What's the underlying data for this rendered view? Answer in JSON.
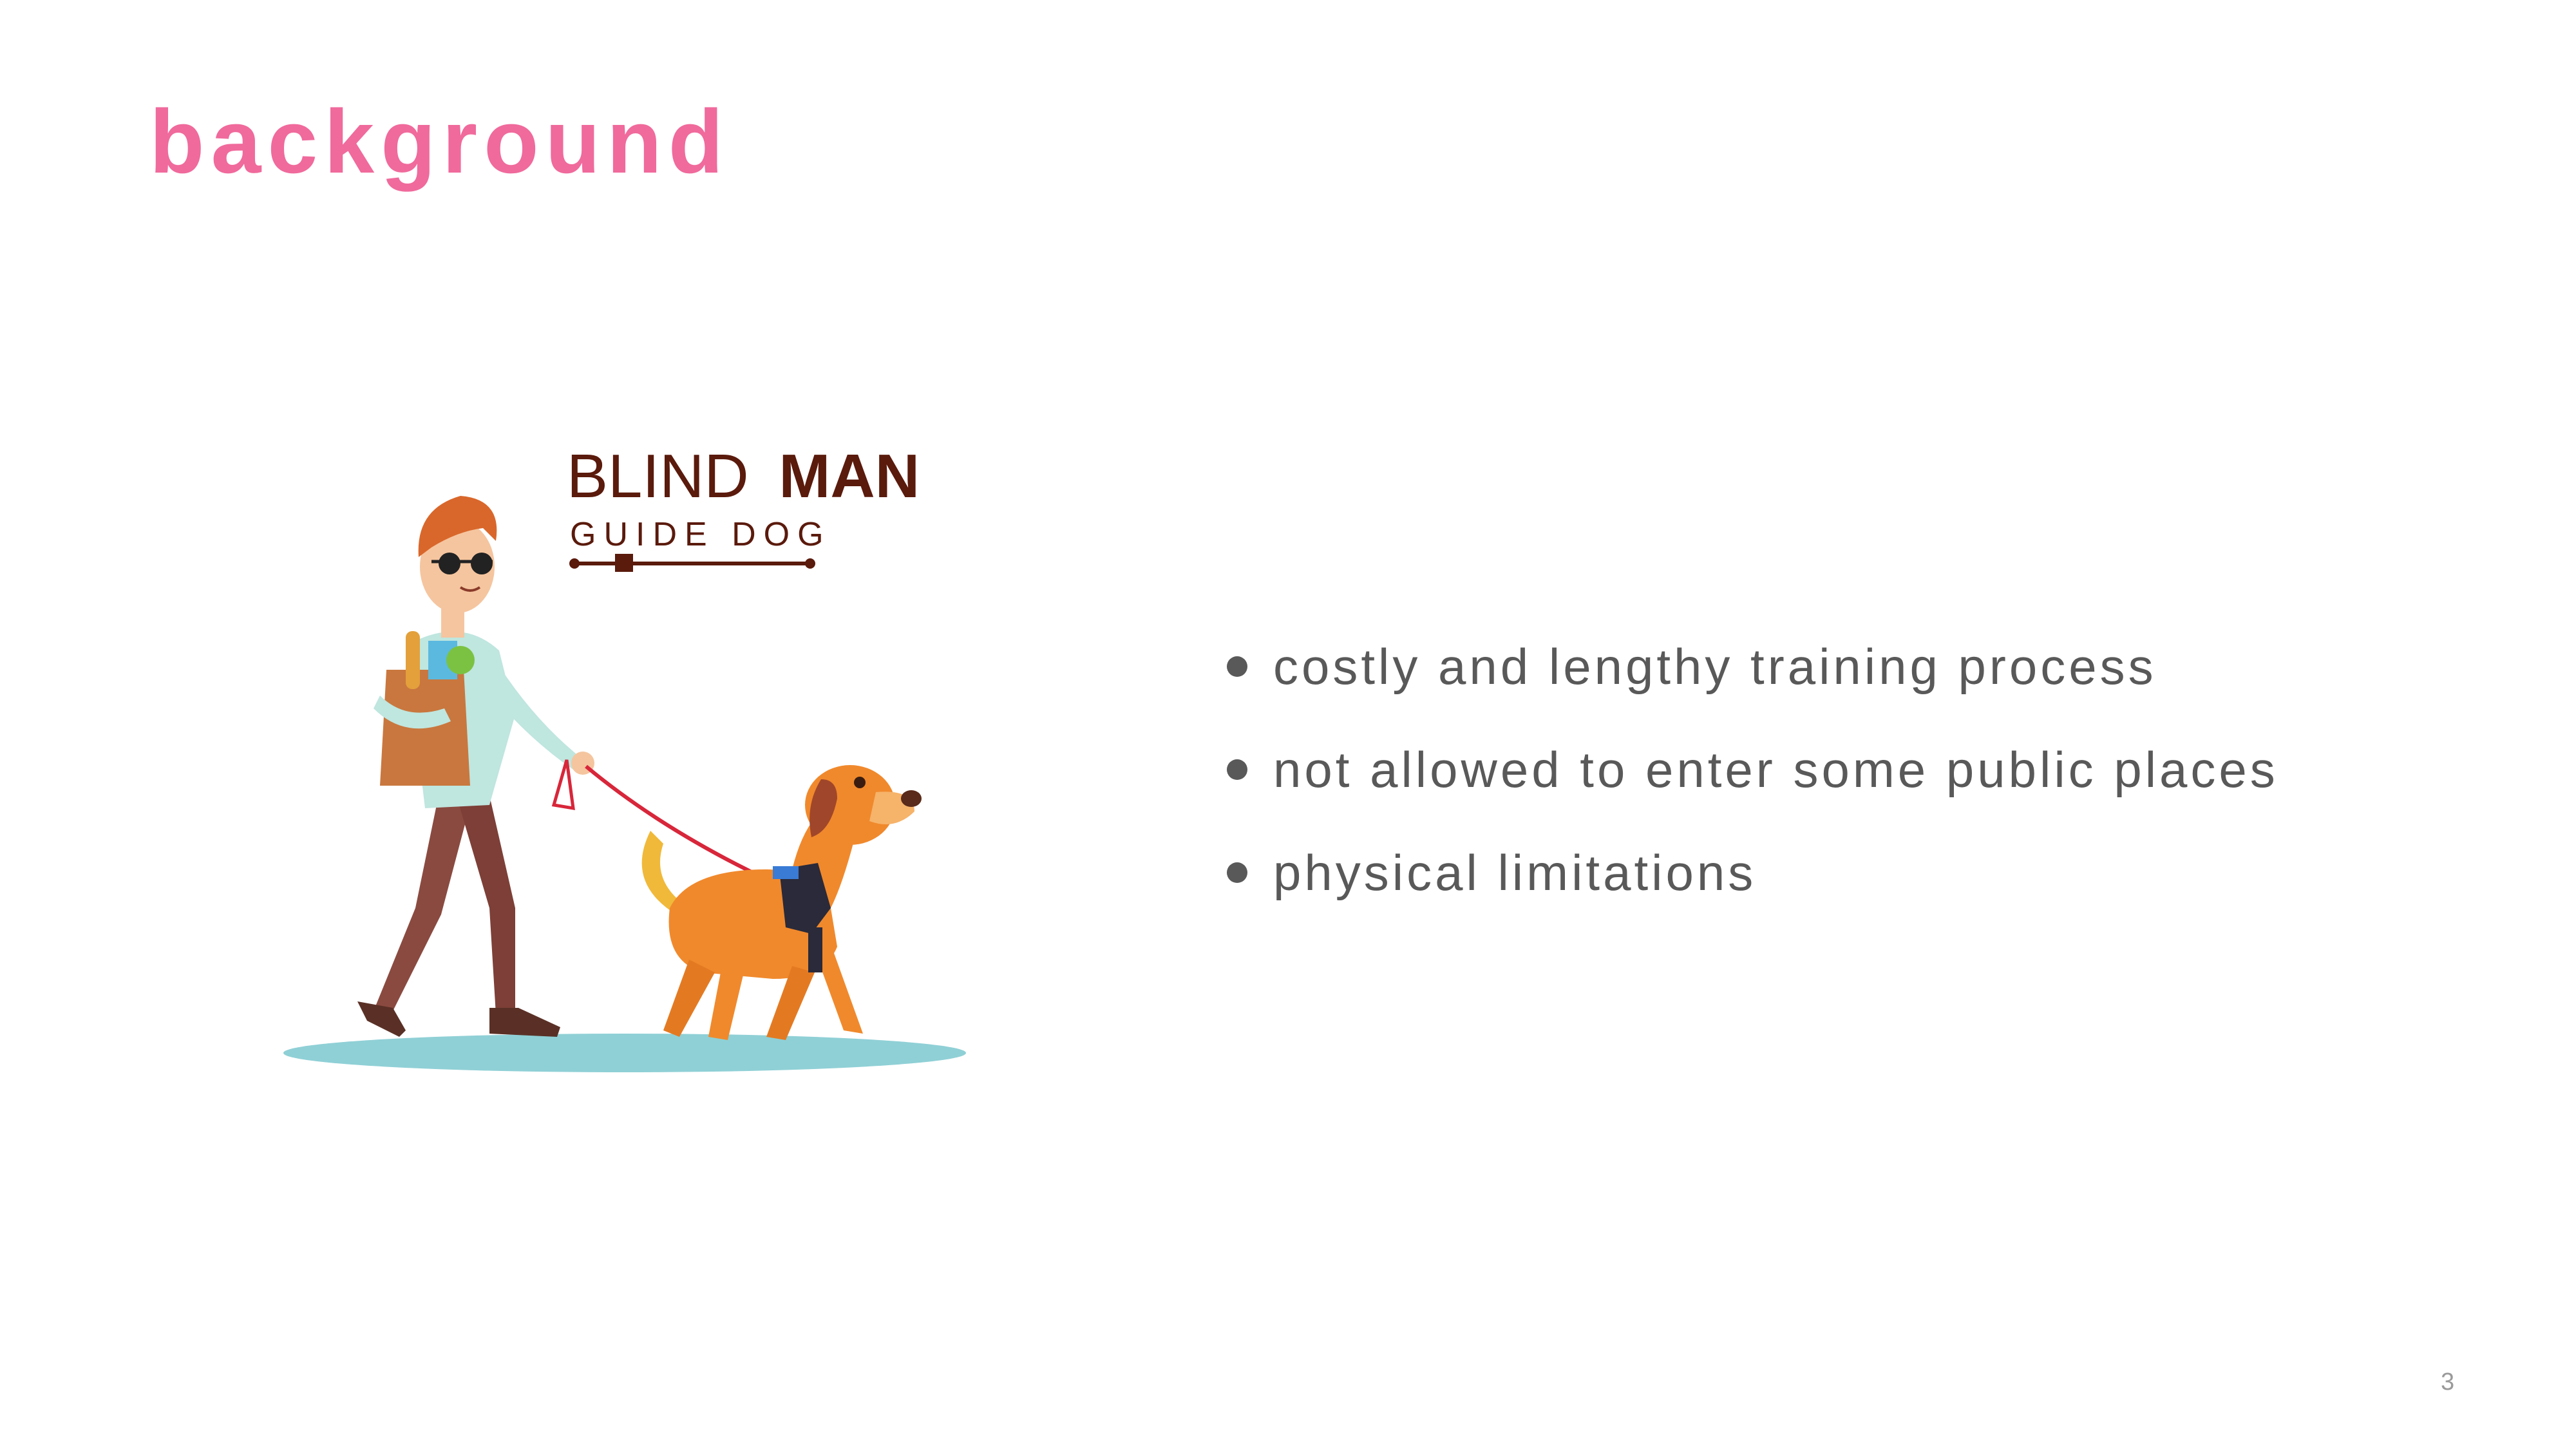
{
  "slide": {
    "title": "background",
    "page_number": "3",
    "bullets": [
      "costly and lengthy training process",
      "not allowed to enter some public places",
      "physical limitations"
    ]
  },
  "illustration": {
    "logo_line1": "BLIND",
    "logo_line1_bold": "MAN",
    "logo_line2": "GUIDE DOG",
    "depicts": "blind man with sunglasses carrying a grocery bag, walking an orange guide dog on a red leash"
  },
  "colors": {
    "title": "#f06a9c",
    "text": "#595959",
    "logo": "#5a1a0c",
    "leash": "#d8263a",
    "dog": "#f0892c",
    "ground": "#8fd0d6"
  }
}
